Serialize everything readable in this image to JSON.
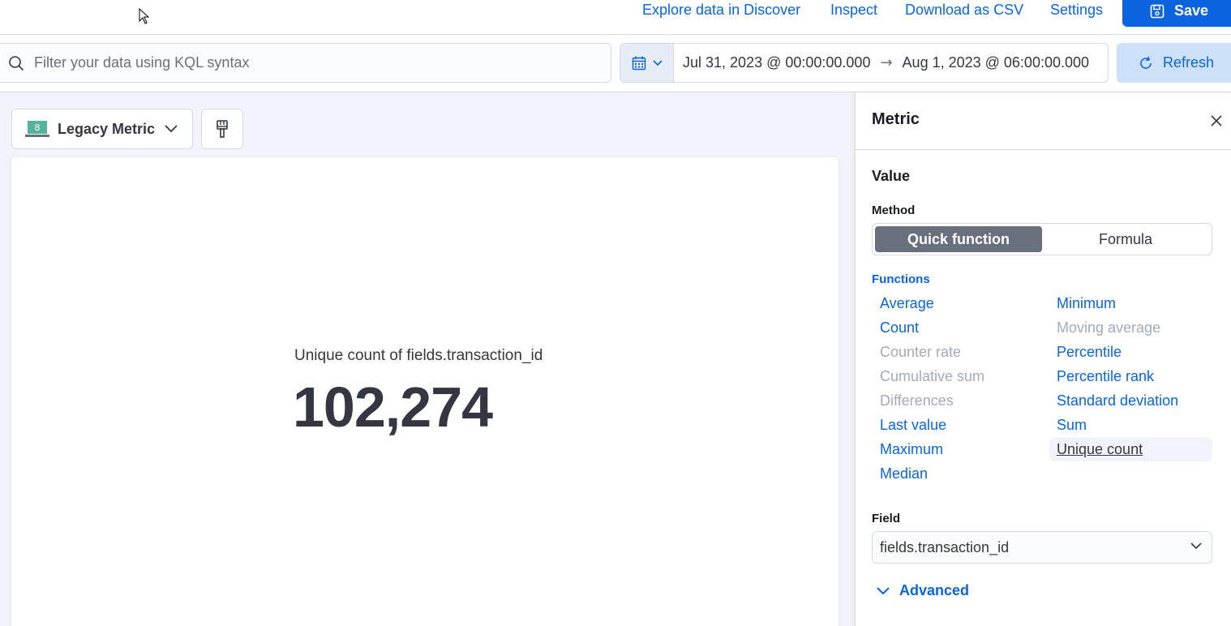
{
  "topbar": {
    "links": [
      {
        "label": "Explore data in Discover"
      },
      {
        "label": "Inspect"
      },
      {
        "label": "Download as CSV"
      },
      {
        "label": "Settings"
      }
    ],
    "save_label": "Save"
  },
  "querybar": {
    "search_placeholder": "Filter your data using KQL syntax",
    "date_start": "Jul 31, 2023 @ 00:00:00.000",
    "date_arrow": "→",
    "date_end": "Aug 1, 2023 @ 06:00:00.000",
    "refresh_label": "Refresh"
  },
  "workspace": {
    "viz_type_label": "Legacy Metric",
    "viz_type_badge": "8",
    "metric_label": "Unique count of fields.transaction_id",
    "metric_value": "102,274"
  },
  "flyout": {
    "title": "Metric",
    "section_title": "Value",
    "method_label": "Method",
    "methods": [
      {
        "label": "Quick function",
        "active": true
      },
      {
        "label": "Formula",
        "active": false
      }
    ],
    "functions_label": "Functions",
    "functions_col1": [
      {
        "label": "Average",
        "disabled": false
      },
      {
        "label": "Count",
        "disabled": false
      },
      {
        "label": "Counter rate",
        "disabled": true
      },
      {
        "label": "Cumulative sum",
        "disabled": true
      },
      {
        "label": "Differences",
        "disabled": true
      },
      {
        "label": "Last value",
        "disabled": false
      },
      {
        "label": "Maximum",
        "disabled": false
      },
      {
        "label": "Median",
        "disabled": false
      }
    ],
    "functions_col2": [
      {
        "label": "Minimum",
        "disabled": false
      },
      {
        "label": "Moving average",
        "disabled": true
      },
      {
        "label": "Percentile",
        "disabled": false
      },
      {
        "label": "Percentile rank",
        "disabled": false
      },
      {
        "label": "Standard deviation",
        "disabled": false
      },
      {
        "label": "Sum",
        "disabled": false
      },
      {
        "label": "Unique count",
        "disabled": false,
        "selected": true
      }
    ],
    "field_label": "Field",
    "field_value": "fields.transaction_id",
    "advanced_label": "Advanced"
  },
  "colors": {
    "accent": "#0b64dd",
    "disabled": "#a2abba",
    "text": "#343741",
    "badge": "#54b399"
  }
}
